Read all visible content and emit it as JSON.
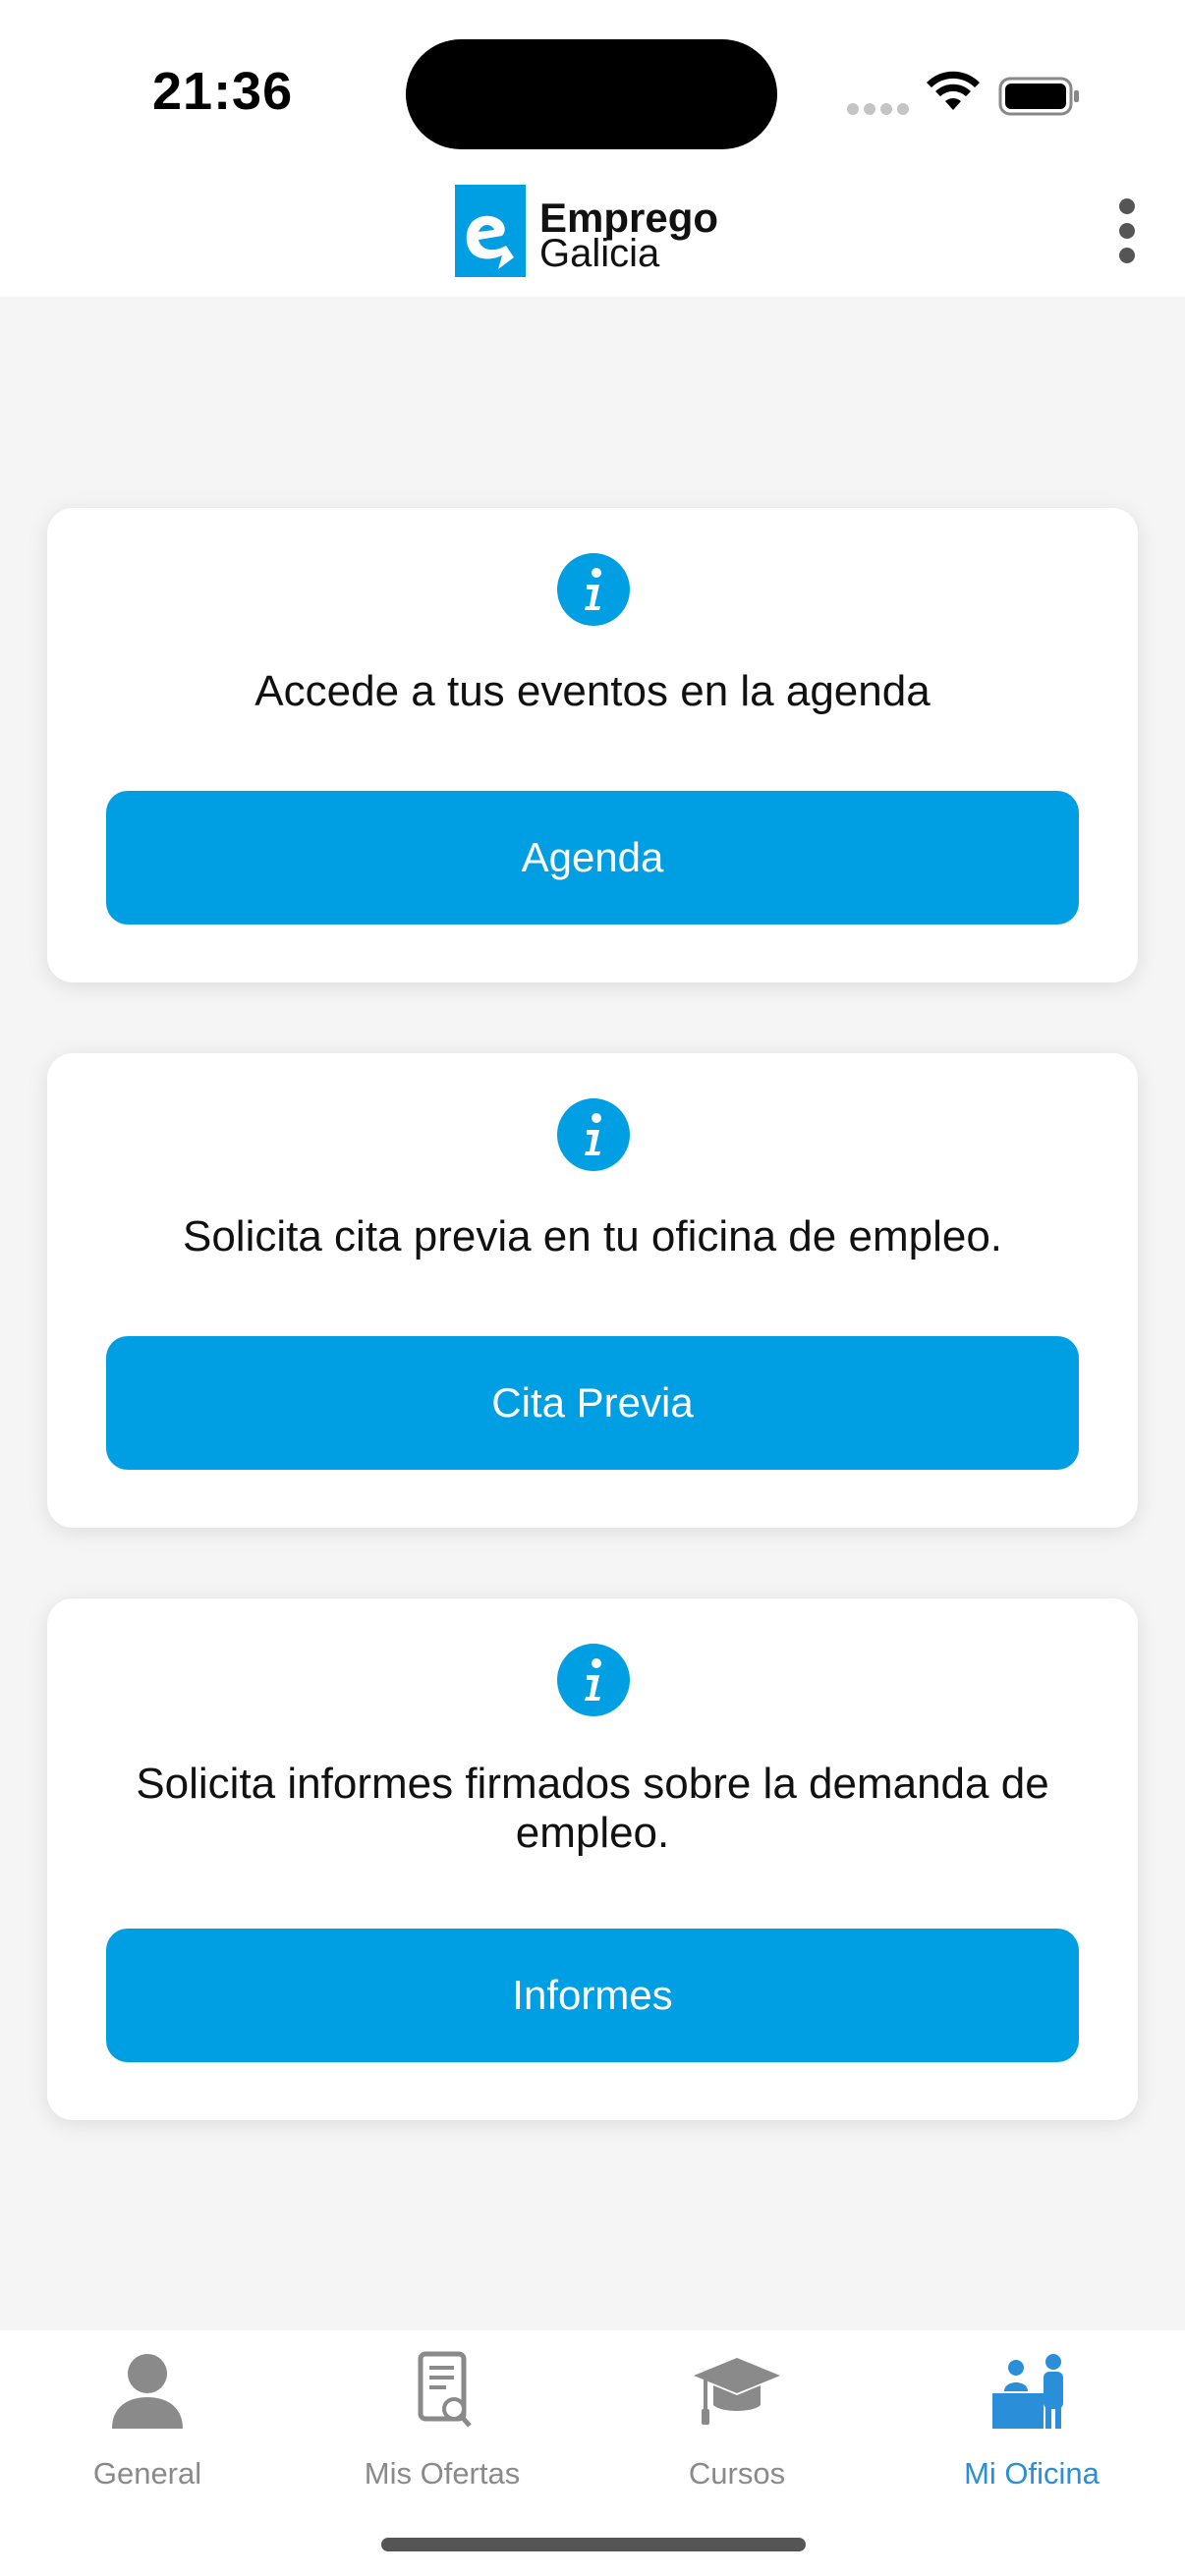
{
  "status_bar": {
    "time": "21:36"
  },
  "header": {
    "logo_line1": "Emprego",
    "logo_line2": "Galicia",
    "menu_icon": "more-vertical-icon"
  },
  "cards": [
    {
      "icon": "info-icon",
      "text": "Accede a tus eventos en la agenda",
      "button_label": "Agenda"
    },
    {
      "icon": "info-icon",
      "text": "Solicita cita previa en tu oficina de empleo.",
      "button_label": "Cita Previa"
    },
    {
      "icon": "info-icon",
      "text": "Solicita informes firmados sobre la demanda de empleo.",
      "button_label": "Informes"
    }
  ],
  "tabs": [
    {
      "label": "General",
      "icon": "person-icon",
      "active": false
    },
    {
      "label": "Mis Ofertas",
      "icon": "document-search-icon",
      "active": false
    },
    {
      "label": "Cursos",
      "icon": "graduation-cap-icon",
      "active": false
    },
    {
      "label": "Mi Oficina",
      "icon": "office-people-icon",
      "active": true
    }
  ],
  "colors": {
    "accent": "#009fe3",
    "active_tab": "#2a8ed8",
    "inactive_tab": "#8a8a8a",
    "background": "#f5f5f5"
  }
}
